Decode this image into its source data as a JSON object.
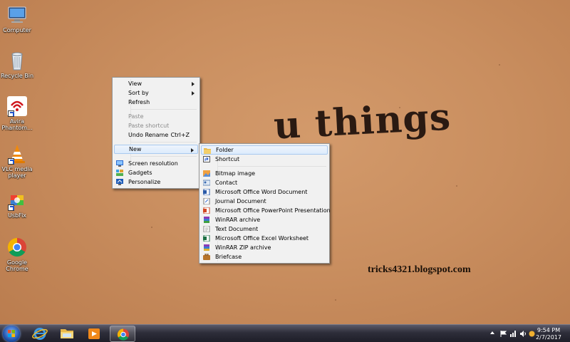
{
  "desktop": {
    "wallpaper_text": "u things",
    "blog_text": "tricks4321.blogspot.com",
    "icons": [
      {
        "label": "Computer",
        "icon": "computer-icon"
      },
      {
        "label": "Recycle Bin",
        "icon": "recycle-bin-icon"
      },
      {
        "label": "Avira Phantom...",
        "icon": "avira-phantom-vpn-icon"
      },
      {
        "label": "VLC media player",
        "icon": "vlc-cone-icon"
      },
      {
        "label": "UsbFix",
        "icon": "usbfix-icon"
      },
      {
        "label": "Google Chrome",
        "icon": "chrome-icon"
      }
    ]
  },
  "context_menu": {
    "items": [
      {
        "label": "View",
        "submenu": true
      },
      {
        "label": "Sort by",
        "submenu": true
      },
      {
        "label": "Refresh"
      },
      {
        "label": "Paste",
        "disabled": true
      },
      {
        "label": "Paste shortcut",
        "disabled": true
      },
      {
        "label": "Undo Rename",
        "shortcut": "Ctrl+Z"
      },
      {
        "label": "New",
        "submenu": true,
        "highlighted": true
      },
      {
        "label": "Screen resolution",
        "icon": "screen-resolution-icon"
      },
      {
        "label": "Gadgets",
        "icon": "gadgets-icon"
      },
      {
        "label": "Personalize",
        "icon": "personalize-icon"
      }
    ]
  },
  "new_submenu": {
    "items": [
      {
        "label": "Folder",
        "icon": "folder-icon",
        "highlighted": true
      },
      {
        "label": "Shortcut",
        "icon": "shortcut-icon"
      },
      {
        "label": "Bitmap image",
        "icon": "bitmap-image-icon"
      },
      {
        "label": "Contact",
        "icon": "contact-icon"
      },
      {
        "label": "Microsoft Office Word Document",
        "icon": "word-document-icon"
      },
      {
        "label": "Journal Document",
        "icon": "journal-document-icon"
      },
      {
        "label": "Microsoft Office PowerPoint Presentation",
        "icon": "powerpoint-icon"
      },
      {
        "label": "WinRAR archive",
        "icon": "winrar-icon"
      },
      {
        "label": "Text Document",
        "icon": "text-document-icon"
      },
      {
        "label": "Microsoft Office Excel Worksheet",
        "icon": "excel-icon"
      },
      {
        "label": "WinRAR ZIP archive",
        "icon": "winrar-zip-icon"
      },
      {
        "label": "Briefcase",
        "icon": "briefcase-icon"
      }
    ]
  },
  "taskbar": {
    "pinned": [
      "internet-explorer-icon",
      "file-explorer-icon",
      "media-player-icon",
      "chrome-icon"
    ],
    "clock_time": "9:54 PM",
    "clock_date": "2/7/2017"
  },
  "colors": {
    "menu_bg": "#f1f1f1",
    "highlight": "#dcebfc",
    "wallpaper": "#c98e5f"
  }
}
